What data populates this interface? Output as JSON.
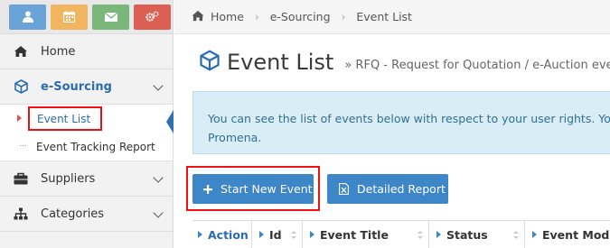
{
  "colors": {
    "accent": "#3d87c9",
    "highlight_border": "#e11111",
    "notice_bg": "#d9edf7"
  },
  "top_icons": [
    "user-icon",
    "calendar-icon",
    "envelope-icon",
    "gears-icon"
  ],
  "sidebar": {
    "items": [
      {
        "label": "Home",
        "icon": "home-icon"
      },
      {
        "label": "e-Sourcing",
        "icon": "cube-icon",
        "active": true
      },
      {
        "label": "Suppliers",
        "icon": "briefcase-icon"
      },
      {
        "label": "Categories",
        "icon": "sitemap-icon"
      }
    ],
    "sub_items": [
      {
        "label": "Event List",
        "selected": true
      },
      {
        "label": "Event Tracking Report"
      }
    ]
  },
  "breadcrumb": {
    "items": [
      "Home",
      "e-Sourcing",
      "Event List"
    ]
  },
  "page": {
    "title": "Event List",
    "subtitle": "» RFQ - Request for Quotation / e-Auction event",
    "notice_line1": "You can see the list of events below with respect to your user rights. You c",
    "notice_line2": "Promena."
  },
  "buttons": {
    "start_new_event": "Start New Event",
    "detailed_report": "Detailed Report"
  },
  "table": {
    "headers": [
      "Action",
      "Id",
      "Event Title",
      "Status",
      "Event Mode"
    ]
  }
}
